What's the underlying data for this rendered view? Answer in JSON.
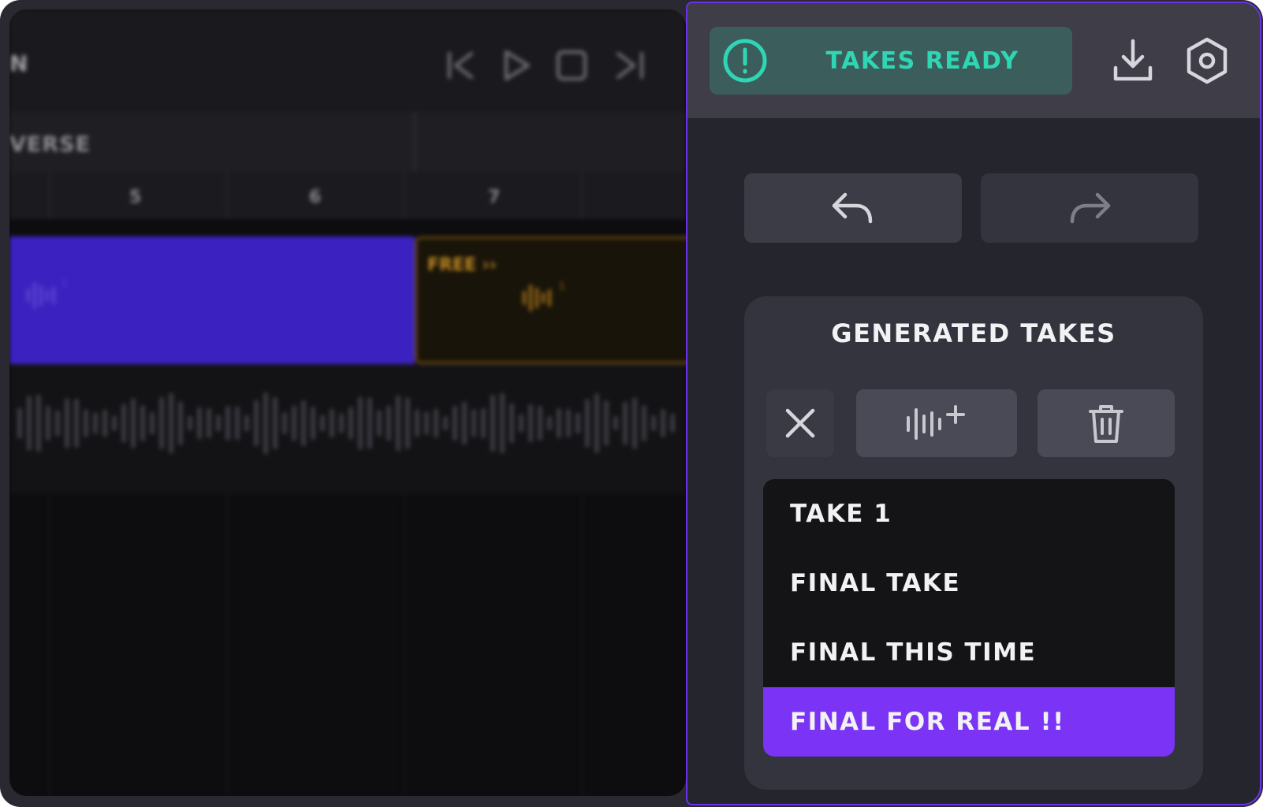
{
  "editor": {
    "title_fragment": "N",
    "section_label": "VERSE",
    "ruler_numbers": [
      "5",
      "6",
      "7"
    ],
    "free_clip_label": "FREE ››",
    "clip_color": "#3b22c0",
    "free_clip_color": "#c08a22"
  },
  "panel": {
    "status": {
      "text": "TAKES READY",
      "icon": "alert-circle-icon",
      "color": "#2fd6b4"
    },
    "header_icons": [
      "download-icon",
      "settings-hexagon-icon"
    ],
    "history": {
      "undo_icon": "undo-arrow-icon",
      "redo_icon": "redo-arrow-icon"
    },
    "takes": {
      "title": "GENERATED TAKES",
      "toolbar": [
        "close-icon",
        "add-waveform-icon",
        "trash-icon"
      ],
      "items": [
        {
          "label": "TAKE 1",
          "selected": false
        },
        {
          "label": "FINAL TAKE",
          "selected": false
        },
        {
          "label": "FINAL THIS TIME",
          "selected": false
        },
        {
          "label": "FINAL FOR REAL !!",
          "selected": true
        }
      ],
      "accent": "#7b33f5"
    }
  }
}
